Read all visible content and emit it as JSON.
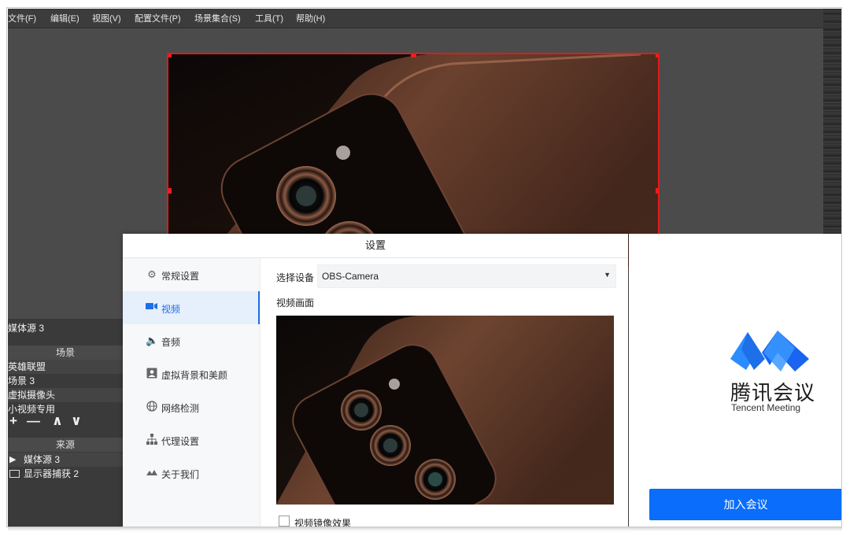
{
  "obs": {
    "menus": [
      "文件(F)",
      "编辑(E)",
      "视图(V)",
      "配置文件(P)",
      "场景集合(S)",
      "工具(T)",
      "帮助(H)"
    ],
    "media_label": "媒体源 3",
    "scenes_title": "场景",
    "scenes": [
      "英雄联盟",
      "场景 3",
      "虚拟摄像头",
      "小视频专用"
    ],
    "scene_tools": [
      "+",
      "—",
      "∧",
      "∨"
    ],
    "sources_title": "来源",
    "sources": [
      {
        "icon": "play-icon",
        "label": "媒体源 3"
      },
      {
        "icon": "monitor-icon",
        "label": "显示器捕获 2"
      }
    ]
  },
  "settings": {
    "title": "设置",
    "nav": [
      {
        "icon": "gear-icon",
        "label": "常规设置"
      },
      {
        "icon": "video-camera-icon",
        "label": "视频"
      },
      {
        "icon": "speaker-icon",
        "label": "音频"
      },
      {
        "icon": "portrait-icon",
        "label": "虚拟背景和美颜"
      },
      {
        "icon": "globe-icon",
        "label": "网络检测"
      },
      {
        "icon": "network-tree-icon",
        "label": "代理设置"
      },
      {
        "icon": "tencent-meeting-logo-icon",
        "label": "关于我们"
      }
    ],
    "active_nav": "视频",
    "device_label": "选择设备",
    "device_value": "OBS-Camera",
    "preview_label": "视频画面",
    "mirror_label": "视频镜像效果",
    "mirror_checked": false
  },
  "tencent_meeting": {
    "app_name": "腾讯会议",
    "app_name_en": "Tencent Meeting",
    "join_button": "加入会议",
    "brand_colors": {
      "primary": "#0a6dfb",
      "logo_blue": "#1e6fe8",
      "logo_light": "#2b8cff"
    }
  }
}
